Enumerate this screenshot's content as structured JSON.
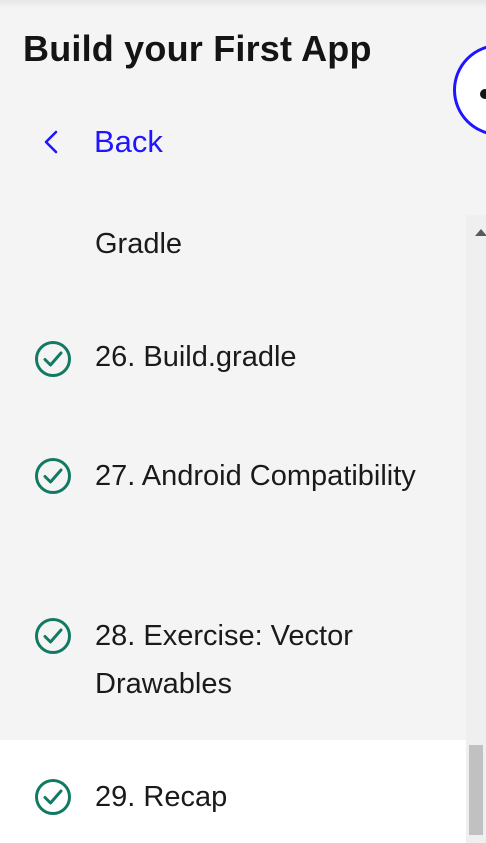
{
  "header": {
    "title": "Build your First App",
    "back_label": "Back"
  },
  "lessons": [
    {
      "label": "Gradle",
      "completed": false
    },
    {
      "label": "26. Build.gradle",
      "completed": true
    },
    {
      "label": "27. Android Compatibility",
      "completed": true
    },
    {
      "label": "28. Exercise: Vector Drawables",
      "completed": true
    },
    {
      "label": "29. Recap",
      "completed": true,
      "active": true
    }
  ],
  "colors": {
    "accent": "#2015ff",
    "check": "#127a63",
    "background": "#f4f4f4",
    "active_row": "#ffffff"
  },
  "icons": {
    "back": "chevron-left-icon",
    "check": "check-circle-icon"
  }
}
